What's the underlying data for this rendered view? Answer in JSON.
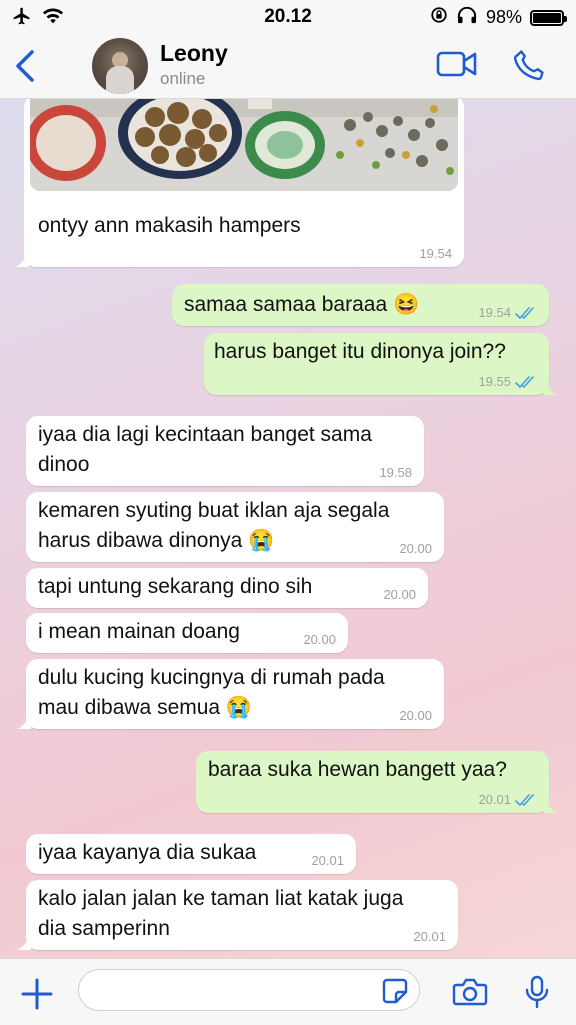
{
  "status_bar": {
    "time": "20.12",
    "battery": "98%",
    "battery_level": 0.98
  },
  "header": {
    "name": "Leony",
    "status": "online"
  },
  "colors": {
    "accent": "#1f5ccf",
    "incoming": "#ffffff",
    "outgoing": "#dcf7c5",
    "tick_read": "#4a9fe0"
  },
  "messages": [
    {
      "dir": "in",
      "text": "ontyy ann makasih hampers",
      "time": "19.54"
    },
    {
      "dir": "out",
      "text": "samaa samaa baraaa 😆",
      "time": "19.54"
    },
    {
      "dir": "out",
      "text": "harus banget itu dinonya join??",
      "time": "19.55"
    },
    {
      "dir": "in",
      "text": "iyaa dia lagi kecintaan banget sama\ndinoo",
      "time": "19.58"
    },
    {
      "dir": "in",
      "text": "kemaren syuting buat iklan aja segala\nharus dibawa dinonya 😭",
      "time": "20.00"
    },
    {
      "dir": "in",
      "text": "tapi untung sekarang dino sih",
      "time": "20.00"
    },
    {
      "dir": "in",
      "text": "i mean mainan doang",
      "time": "20.00"
    },
    {
      "dir": "in",
      "text": "dulu kucing kucingnya di rumah pada\nmau dibawa semua 😭",
      "time": "20.00"
    },
    {
      "dir": "out",
      "text": "baraa suka hewan bangett yaa?",
      "time": "20.01"
    },
    {
      "dir": "in",
      "text": "iyaa kayanya dia sukaa",
      "time": "20.01"
    },
    {
      "dir": "in",
      "text": "kalo jalan jalan ke taman liat katak juga\ndia samperinn",
      "time": "20.01"
    }
  ]
}
